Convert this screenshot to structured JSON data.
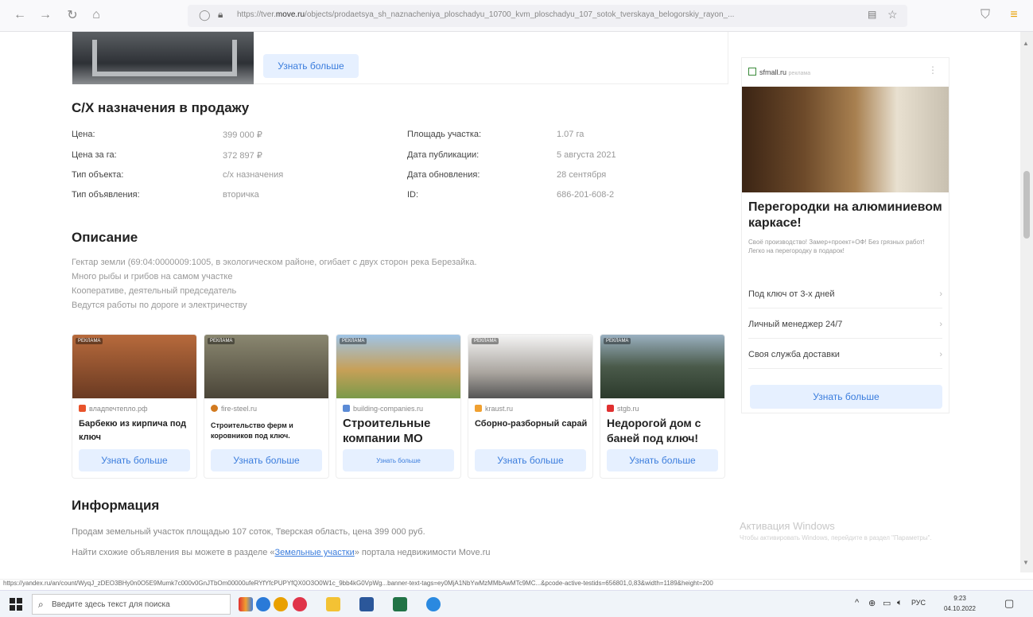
{
  "browser": {
    "url_prefix": "https://tver.",
    "url_domain": "move.ru",
    "url_rest": "/objects/prodaetsya_sh_naznacheniya_ploschadyu_10700_kvm_ploschadyu_107_sotok_tverskaya_belogorskiy_rayon_..."
  },
  "top_card": {
    "button": "Узнать больше"
  },
  "listing": {
    "title": "С/Х назначения в продажу",
    "left": [
      {
        "label": "Цена:",
        "value": "399 000 ₽"
      },
      {
        "label": "Цена за га:",
        "value": "372 897 ₽"
      },
      {
        "label": "Тип объекта:",
        "value": "с/х назначения"
      },
      {
        "label": "Тип объявления:",
        "value": "вторичка"
      }
    ],
    "right": [
      {
        "label": "Площадь участка:",
        "value": "1.07 га"
      },
      {
        "label": "Дата публикации:",
        "value": "5 августа 2021"
      },
      {
        "label": "Дата обновления:",
        "value": "28 сентября"
      },
      {
        "label": "ID:",
        "value": "686-201-608-2"
      }
    ]
  },
  "description": {
    "title": "Описание",
    "lines": [
      "Гектар земли (69:04:0000009:1005, в экологическом районе, огибает с двух сторон река Березайка.",
      "Много рыбы и грибов на самом участке",
      "Кооперативе, деятельный председатель",
      "Ведутся работы по дороге и электричеству"
    ]
  },
  "ads": [
    {
      "tag": "РЕКЛАМА",
      "source": "владпечтепло.рф",
      "title": "Барбекю из кирпича под ключ",
      "button": "Узнать больше",
      "color": "#8a4a2a",
      "icon": "#e8532b"
    },
    {
      "tag": "РЕКЛАМА",
      "source": "fire-steel.ru",
      "title": "Строительство ферм и коровников под ключ.",
      "button": "Узнать больше",
      "color": "#6b6a55",
      "icon": "#d27a1f"
    },
    {
      "tag": "РЕКЛАМА",
      "source": "building-companies.ru",
      "title": "Строительные компании МО",
      "button": "Узнать больше",
      "color": "#c7a058",
      "icon": "#5b8bd6"
    },
    {
      "tag": "РЕКЛАМА",
      "source": "kraust.ru",
      "title": "Сборно-разборный сарай",
      "button": "Узнать больше",
      "color": "#a9a49e",
      "icon": "#f0a030"
    },
    {
      "tag": "РЕКЛАМА",
      "source": "stgb.ru",
      "title": "Недорогой дом с баней под ключ!",
      "button": "Узнать больше",
      "color": "#4a5a4a",
      "icon": "#e03030"
    }
  ],
  "info": {
    "title": "Информация",
    "line1": "Продам земельный участок площадью 107 соток, Тверская область, цена 399 000 руб.",
    "line2_before": "Найти схожие объявления вы можете в разделе «",
    "line2_link": "Земельные участки",
    "line2_after": "» портала недвижимости Move.ru"
  },
  "side_ad": {
    "source": "sfmall.ru",
    "source_tag": "реклама",
    "title": "Перегородки на алюминиевом каркасе!",
    "text": "Своё производство! Замер+проект+ОФ! Без грязных работ! Легко на перегородку в подарок!",
    "rows": [
      "Под ключ от 3-х дней",
      "Личный менеджер 24/7",
      "Своя служба доставки"
    ],
    "button": "Узнать больше"
  },
  "windows_activation": {
    "title": "Активация Windows",
    "text": "Чтобы активировать Windows, перейдите в раздел \"Параметры\"."
  },
  "status_url": "https://yandex.ru/an/count/WyqJ_zDEO3BHy0n0O5E9Mumk7c000v0GnJTbOm00000ufeRYfYfcPUPYfQX0O3O0W1c_9bb4kG0VpWg...banner-text-tags=ey0MjA1NbYwMzMMbAwMTc9MC...&pcode-active-testids=656801,0,83&width=1189&height=200",
  "taskbar": {
    "search_placeholder": "Введите здесь текст для поиска",
    "lang": "РУС",
    "time": "9:23",
    "date": "04.10.2022"
  }
}
